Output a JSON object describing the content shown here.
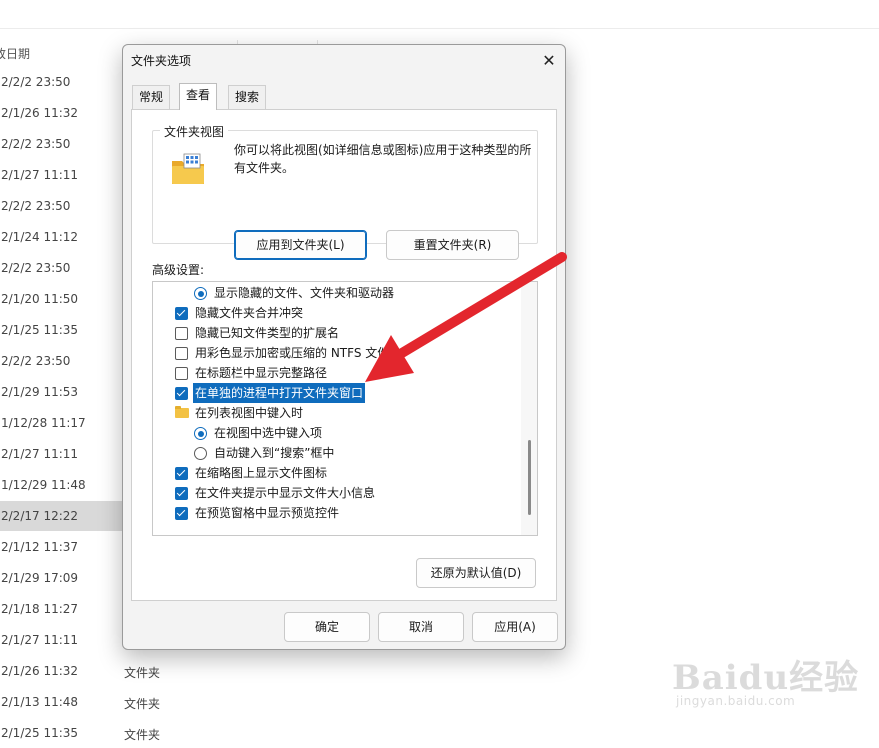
{
  "background": {
    "column_header": "改日期",
    "dates": [
      "2/2/2 23:50",
      "2/1/26 11:32",
      "2/2/2 23:50",
      "2/1/27 11:11",
      "2/2/2 23:50",
      "2/1/24 11:12",
      "2/2/2 23:50",
      "2/1/20 11:50",
      "2/1/25 11:35",
      "2/2/2 23:50",
      "2/1/29 11:53",
      "1/12/28 11:17",
      "2/1/27 11:11",
      "1/12/29 11:48",
      "2/2/17 12:22",
      "2/1/12 11:37",
      "2/1/29 17:09",
      "2/1/18 11:27",
      "2/1/27 11:11",
      "2/1/26 11:32",
      "2/1/13 11:48",
      "2/1/25 11:35"
    ],
    "selected_index": 14,
    "type_label": "文件夹"
  },
  "dialog": {
    "title": "文件夹选项",
    "close_glyph": "✕",
    "tabs": [
      {
        "label": "常规",
        "active": false
      },
      {
        "label": "查看",
        "active": true
      },
      {
        "label": "搜索",
        "active": false
      }
    ],
    "folder_view": {
      "group_label": "文件夹视图",
      "description": "你可以将此视图(如详细信息或图标)应用于这种类型的所有文件夹。",
      "apply_button": "应用到文件夹(L)",
      "reset_button": "重置文件夹(R)"
    },
    "advanced_label": "高级设置:",
    "advanced_items": [
      {
        "kind": "radio",
        "checked": true,
        "indent": 1,
        "text": "显示隐藏的文件、文件夹和驱动器"
      },
      {
        "kind": "checkbox",
        "checked": true,
        "indent": 0,
        "text": "隐藏文件夹合并冲突"
      },
      {
        "kind": "checkbox",
        "checked": false,
        "indent": 0,
        "text": "隐藏已知文件类型的扩展名"
      },
      {
        "kind": "checkbox",
        "checked": false,
        "indent": 0,
        "text": "用彩色显示加密或压缩的 NTFS 文件"
      },
      {
        "kind": "checkbox",
        "checked": false,
        "indent": 0,
        "text": "在标题栏中显示完整路径"
      },
      {
        "kind": "checkbox",
        "checked": true,
        "indent": 0,
        "text": "在单独的进程中打开文件夹窗口",
        "highlighted": true
      },
      {
        "kind": "folder",
        "checked": false,
        "indent": 0,
        "text": "在列表视图中键入时"
      },
      {
        "kind": "radio",
        "checked": true,
        "indent": 1,
        "text": "在视图中选中键入项"
      },
      {
        "kind": "radio",
        "checked": false,
        "indent": 1,
        "text": "自动键入到“搜索”框中"
      },
      {
        "kind": "checkbox",
        "checked": true,
        "indent": 0,
        "text": "在缩略图上显示文件图标"
      },
      {
        "kind": "checkbox",
        "checked": true,
        "indent": 0,
        "text": "在文件夹提示中显示文件大小信息"
      },
      {
        "kind": "checkbox",
        "checked": true,
        "indent": 0,
        "text": "在预览窗格中显示预览控件"
      }
    ],
    "restore_button": "还原为默认值(D)",
    "ok_button": "确定",
    "cancel_button": "取消",
    "apply_button": "应用(A)"
  },
  "watermark": {
    "logo": "Baidu经验",
    "url": "jingyan.baidu.com"
  },
  "colors": {
    "accent": "#0f6cbd",
    "arrow": "#e3262d",
    "selected_row": "#d9d9d9"
  }
}
